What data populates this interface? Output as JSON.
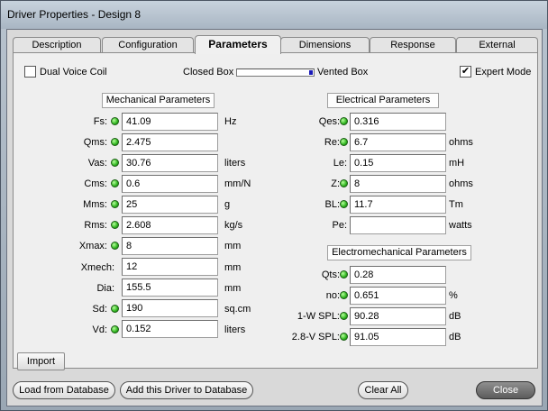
{
  "window": {
    "title": "Driver Properties - Design 8"
  },
  "tabs": [
    {
      "label": "Description"
    },
    {
      "label": "Configuration"
    },
    {
      "label": "Parameters"
    },
    {
      "label": "Dimensions"
    },
    {
      "label": "Response"
    },
    {
      "label": "External"
    }
  ],
  "options": {
    "dual_voice_coil": "Dual Voice Coil",
    "closed_box": "Closed Box",
    "vented_box": "Vented Box",
    "expert_mode": "Expert Mode",
    "expert_mode_check": "✔"
  },
  "mechanical": {
    "heading": "Mechanical Parameters",
    "rows": [
      {
        "label": "Fs:",
        "value": "41.09",
        "unit": "Hz"
      },
      {
        "label": "Qms:",
        "value": "2.475",
        "unit": ""
      },
      {
        "label": "Vas:",
        "value": "30.76",
        "unit": "liters"
      },
      {
        "label": "Cms:",
        "value": "0.6",
        "unit": "mm/N"
      },
      {
        "label": "Mms:",
        "value": "25",
        "unit": "g"
      },
      {
        "label": "Rms:",
        "value": "2.608",
        "unit": "kg/s"
      },
      {
        "label": "Xmax:",
        "value": "8",
        "unit": "mm"
      },
      {
        "label": "Xmech:",
        "value": "12",
        "unit": "mm"
      },
      {
        "label": "Dia:",
        "value": "155.5",
        "unit": "mm"
      },
      {
        "label": "Sd:",
        "value": "190",
        "unit": "sq.cm"
      },
      {
        "label": "Vd:",
        "value": "0.152",
        "unit": "liters"
      }
    ]
  },
  "electrical": {
    "heading": "Electrical Parameters",
    "rows": [
      {
        "label": "Qes:",
        "value": "0.316",
        "unit": ""
      },
      {
        "label": "Re:",
        "value": "6.7",
        "unit": "ohms"
      },
      {
        "label": "Le:",
        "value": "0.15",
        "unit": "mH"
      },
      {
        "label": "Z:",
        "value": "8",
        "unit": "ohms"
      },
      {
        "label": "BL:",
        "value": "11.7",
        "unit": "Tm"
      },
      {
        "label": "Pe:",
        "value": "",
        "unit": "watts"
      }
    ]
  },
  "electromechanical": {
    "heading": "Electromechanical Parameters",
    "rows": [
      {
        "label": "Qts:",
        "value": "0.28",
        "unit": ""
      },
      {
        "label": "no:",
        "value": "0.651",
        "unit": "%"
      },
      {
        "label": "1-W SPL:",
        "value": "90.28",
        "unit": "dB"
      },
      {
        "label": "2.8-V SPL:",
        "value": "91.05",
        "unit": "dB"
      }
    ]
  },
  "buttons": {
    "import": "Import",
    "load_from_database": "Load from Database",
    "add_to_database": "Add this Driver to Database",
    "clear_all": "Clear All",
    "close": "Close"
  }
}
